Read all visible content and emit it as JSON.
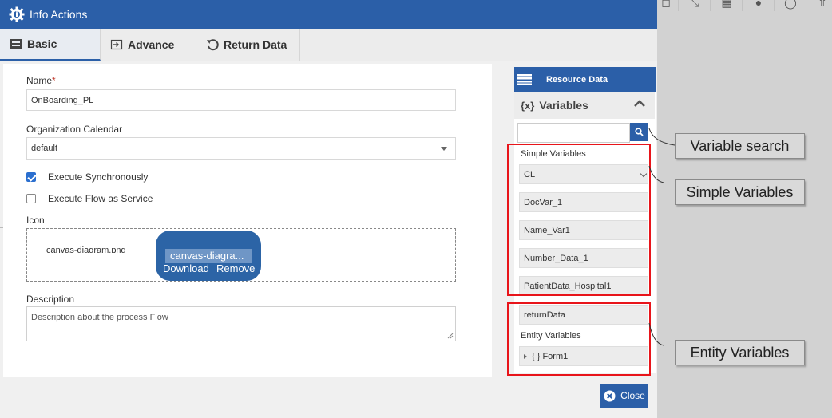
{
  "dialog": {
    "title": "Info Actions",
    "tabs": [
      {
        "label": "Basic"
      },
      {
        "label": "Advance"
      },
      {
        "label": "Return Data"
      }
    ]
  },
  "form": {
    "name_label": "Name",
    "name_required_mark": "*",
    "name_value": "OnBoarding_PL",
    "calendar_label": "Organization Calendar",
    "calendar_value": "default",
    "execute_sync_label": "Execute Synchronously",
    "execute_sync_checked": true,
    "flow_service_label": "Execute Flow as Service",
    "flow_service_checked": false,
    "icon_label": "Icon",
    "icon_filename": "canvas-diagram.png",
    "icon_bubble_name": "canvas-diagra...",
    "icon_download": "Download",
    "icon_remove": "Remove",
    "description_label": "Description",
    "description_value": "Description about the process Flow"
  },
  "resource": {
    "header": "Resource Data",
    "variables_title": "Variables",
    "variables_icon": "{x}",
    "simple_label": "Simple Variables",
    "simple_items": [
      "CL",
      "DocVar_1",
      "Name_Var1",
      "Number_Data_1",
      "PatientData_Hospital1",
      "returnData"
    ],
    "entity_label": "Entity Variables",
    "entity_items": [
      "{ } Form1"
    ]
  },
  "close_label": "Close",
  "annotations": {
    "search": "Variable search",
    "simple": "Simple Variables",
    "entity": "Entity Variables"
  },
  "colors": {
    "primary": "#2b5fa8",
    "annotation_red": "#e8141a"
  }
}
